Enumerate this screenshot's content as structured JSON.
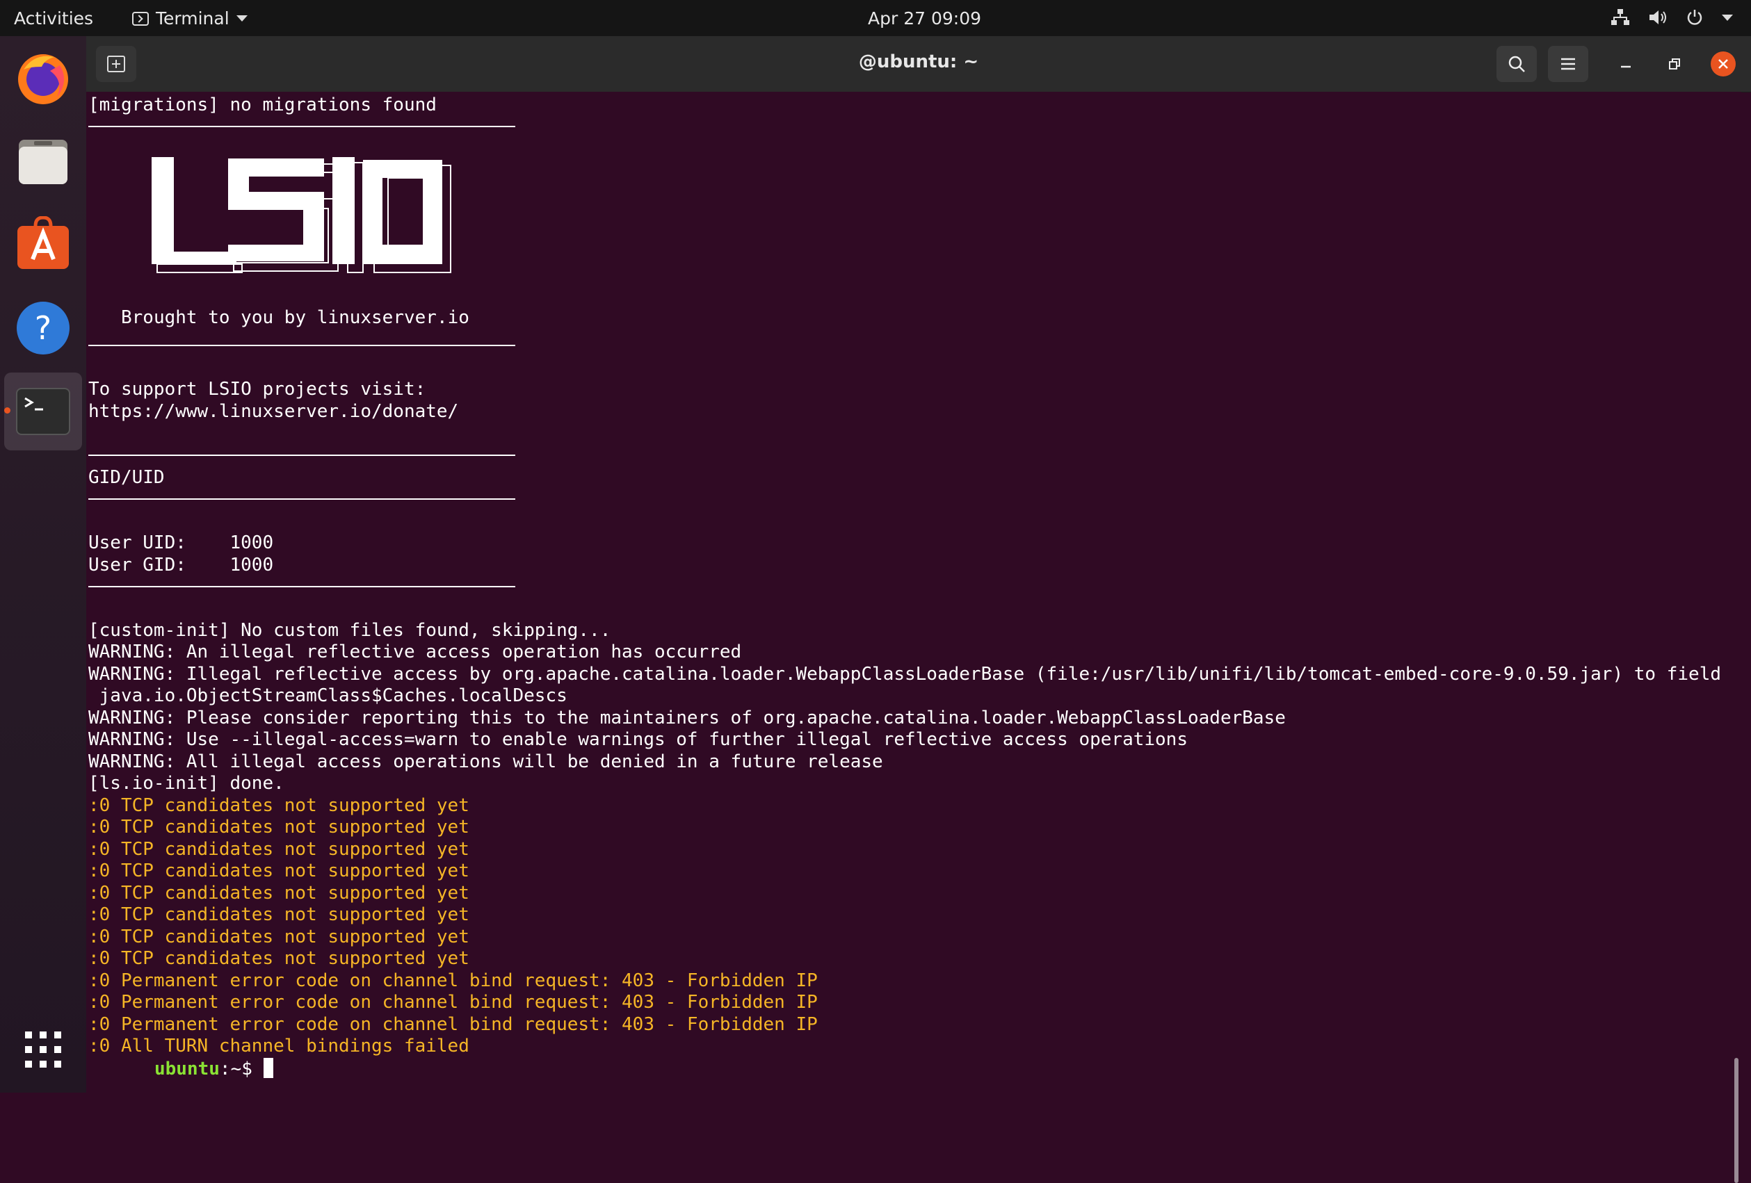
{
  "topbar": {
    "activities": "Activities",
    "app_name": "Terminal",
    "clock": "Apr 27  09:09"
  },
  "dock": {
    "items": [
      "firefox",
      "files",
      "ubuntu-software",
      "help",
      "terminal"
    ],
    "apps_grid": "show-applications"
  },
  "window": {
    "title": "@ubuntu: ~"
  },
  "terminal": {
    "l_migrations": "[migrations] no migrations found",
    "logo_text": "LSIO",
    "l_brought": "Brought to you by linuxserver.io",
    "l_support": "To support LSIO projects visit:",
    "l_url": "https://www.linuxserver.io/donate/",
    "l_giduid": "GID/UID",
    "l_uid": "User UID:    1000",
    "l_gid": "User GID:    1000",
    "l_custom": "[custom-init] No custom files found, skipping...",
    "l_w1": "WARNING: An illegal reflective access operation has occurred",
    "l_w2": "WARNING: Illegal reflective access by org.apache.catalina.loader.WebappClassLoaderBase (file:/usr/lib/unifi/lib/tomcat-embed-core-9.0.59.jar) to field",
    "l_w2b": " java.io.ObjectStreamClass$Caches.localDescs",
    "l_w3": "WARNING: Please consider reporting this to the maintainers of org.apache.catalina.loader.WebappClassLoaderBase",
    "l_w4": "WARNING: Use --illegal-access=warn to enable warnings of further illegal reflective access operations",
    "l_w5": "WARNING: All illegal access operations will be denied in a future release",
    "l_done": "[ls.io-init] done.",
    "l_tcp": ":0 TCP candidates not supported yet",
    "l_perm": ":0 Permanent error code on channel bind request: 403 - Forbidden IP",
    "l_turn": ":0 All TURN channel bindings failed",
    "prompt_user": "ubuntu",
    "prompt_rest": ":~$ "
  }
}
